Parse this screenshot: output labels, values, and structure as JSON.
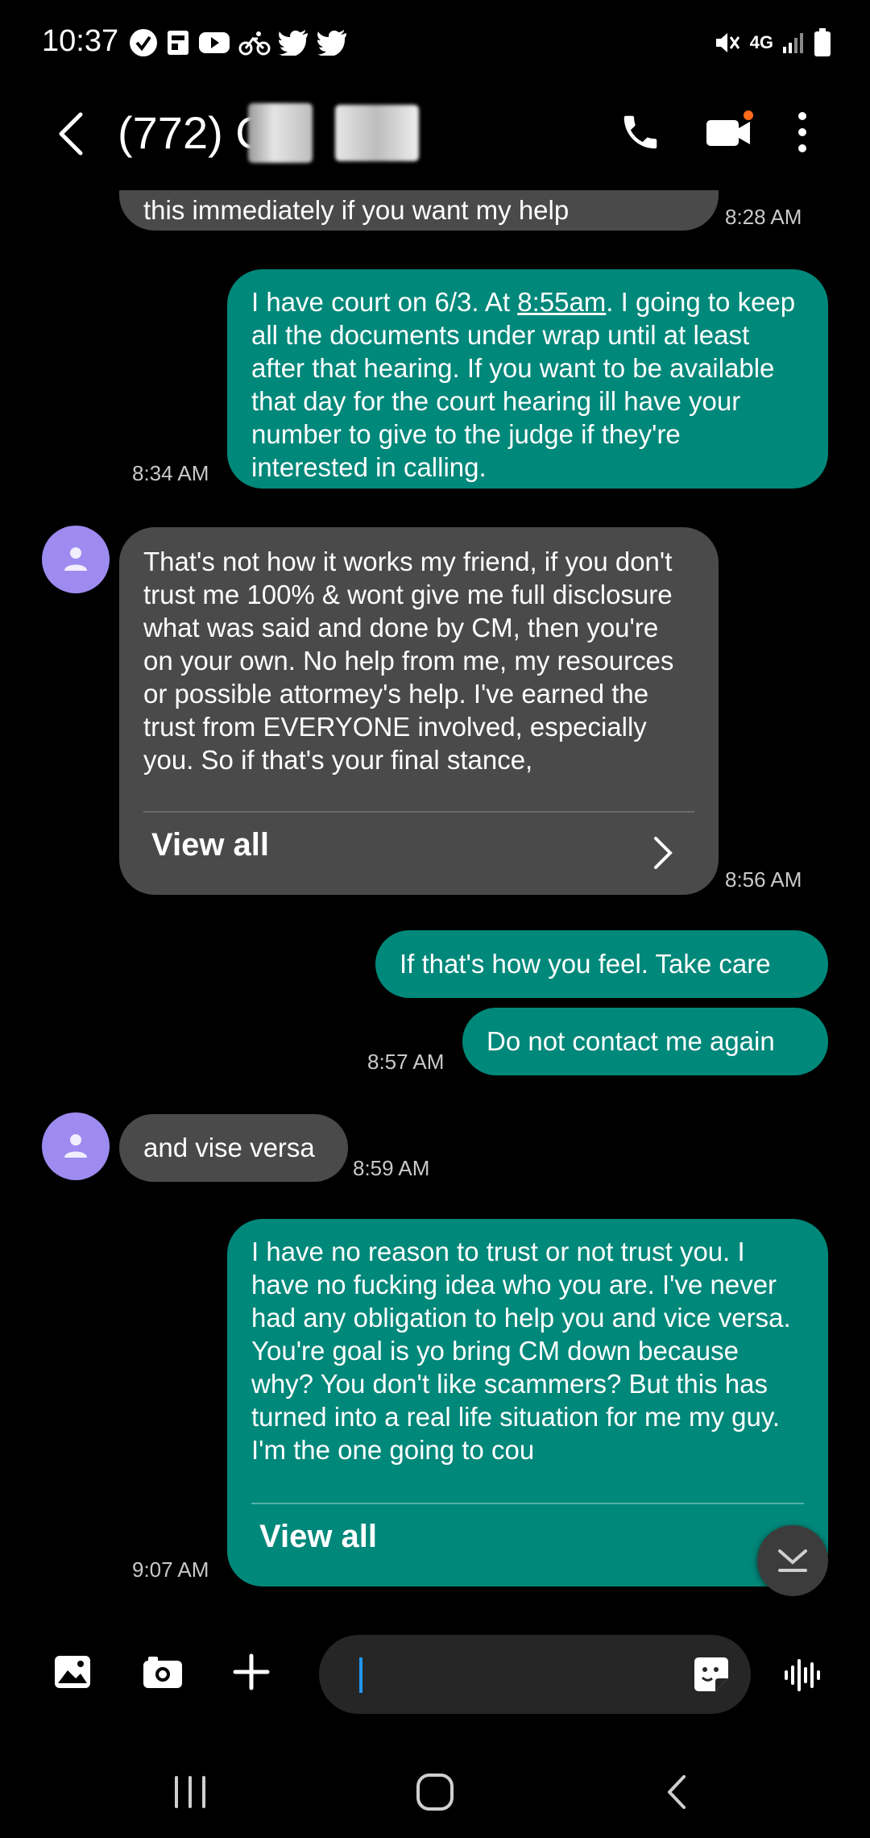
{
  "status": {
    "time": "10:37",
    "network": "4G"
  },
  "header": {
    "contact": "(772) C"
  },
  "messages": {
    "m1": {
      "text": "this immediately if you want my help",
      "time": "8:28 AM"
    },
    "m2": {
      "line1_a": "I have court on 6/3. At ",
      "line1_link": "8:55am",
      "line1_b": ". I going to",
      "rest": "keep all the documents under wrap until at least after that hearing.  If you want to be available that day for the court hearing ill have your number to give to the judge if they're interested in calling.",
      "time": "8:34 AM"
    },
    "m3": {
      "text": "That's not how it works my friend, if you don't trust me 100% & wont give me full disclosure what was said and done by CM, then you're on your own. No help from me, my resources or possible attormey's help. I've earned the trust from EVERYONE involved, especially you. So if that's your final stance,",
      "view_all": "View all",
      "time": "8:56 AM"
    },
    "m4": {
      "text": "If that's how you feel.  Take care"
    },
    "m5": {
      "text": "Do not contact me again",
      "time": "8:57 AM"
    },
    "m6": {
      "text": "and vise versa",
      "time": "8:59 AM"
    },
    "m7": {
      "text": "I have no reason to trust or not trust you.  I have no fucking idea who you are.  I've never had any obligation to help you and vice versa.  You're goal is yo bring CM down because why?  You don't like scammers?  But this has turned into a real life situation for me my guy.  I'm the one going to cou",
      "view_all": "View all",
      "time": "9:07 AM"
    }
  },
  "colors": {
    "incoming_bubble": "#4a4a4a",
    "outgoing_bubble": "#00887a",
    "avatar": "#9e8bf0",
    "cursor": "#2196f3"
  },
  "icons": {
    "left_status": [
      "v-check-icon",
      "p-badge-icon",
      "youtube-icon",
      "bike-icon",
      "twitter-icon",
      "twitter-icon"
    ],
    "right_status": [
      "mute-icon",
      "4g-icon",
      "signal-icon",
      "battery-icon"
    ],
    "header": [
      "back-icon",
      "phone-icon",
      "video-call-icon",
      "more-icon"
    ],
    "compose": [
      "gallery-icon",
      "camera-icon",
      "plus-icon",
      "sticker-icon",
      "voice-icon"
    ],
    "nav": [
      "recents-icon",
      "home-icon",
      "back-nav-icon"
    ]
  }
}
